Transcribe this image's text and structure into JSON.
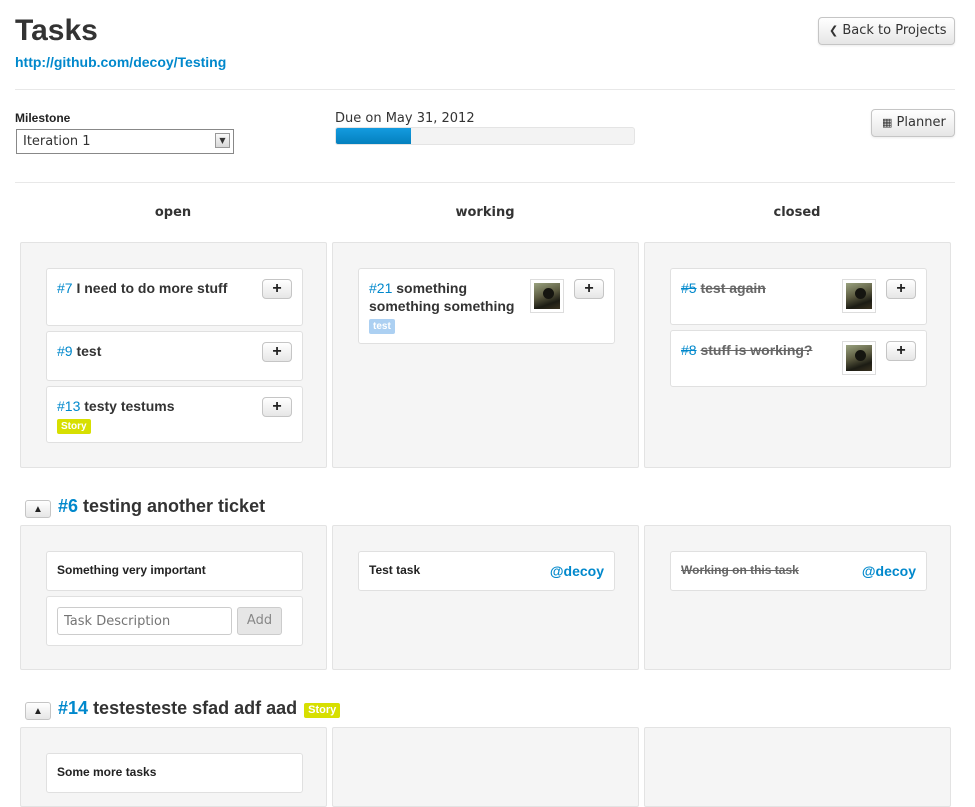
{
  "page": {
    "title": "Tasks",
    "repo_url": "http://github.com/decoy/Testing"
  },
  "buttons": {
    "back": "Back to Projects",
    "planner": "Planner"
  },
  "milestone": {
    "label": "Milestone",
    "selected": "Iteration 1",
    "due": "Due on May 31, 2012",
    "progress_fraction": 0.25
  },
  "columns": [
    "open",
    "working",
    "closed"
  ],
  "board": {
    "open": [
      {
        "num": "#7",
        "title": "I need to do more stuff"
      },
      {
        "num": "#9",
        "title": "test"
      },
      {
        "num": "#13",
        "title": "testy testums",
        "tag": "Story"
      }
    ],
    "working": [
      {
        "num": "#21",
        "title": "something something something",
        "tag": "test"
      }
    ],
    "closed": [
      {
        "num": "#5",
        "title": "test again"
      },
      {
        "num": "#8",
        "title": "stuff is working?"
      }
    ]
  },
  "tickets": [
    {
      "num": "#6",
      "title": "testing another ticket",
      "open_task": "Something very important",
      "add_placeholder": "Task Description",
      "add_label": "Add",
      "working_task": "Test task",
      "working_user": "@decoy",
      "closed_task": "Working on this task",
      "closed_user": "@decoy"
    },
    {
      "num": "#14",
      "title": "testesteste sfad adf aad",
      "tag": "Story",
      "open_task": "Some more tasks"
    }
  ],
  "colors": {
    "link": "#0088cc",
    "story_tag": "#d7df01",
    "test_tag": "#acd0f2",
    "progress": "#0480be"
  }
}
